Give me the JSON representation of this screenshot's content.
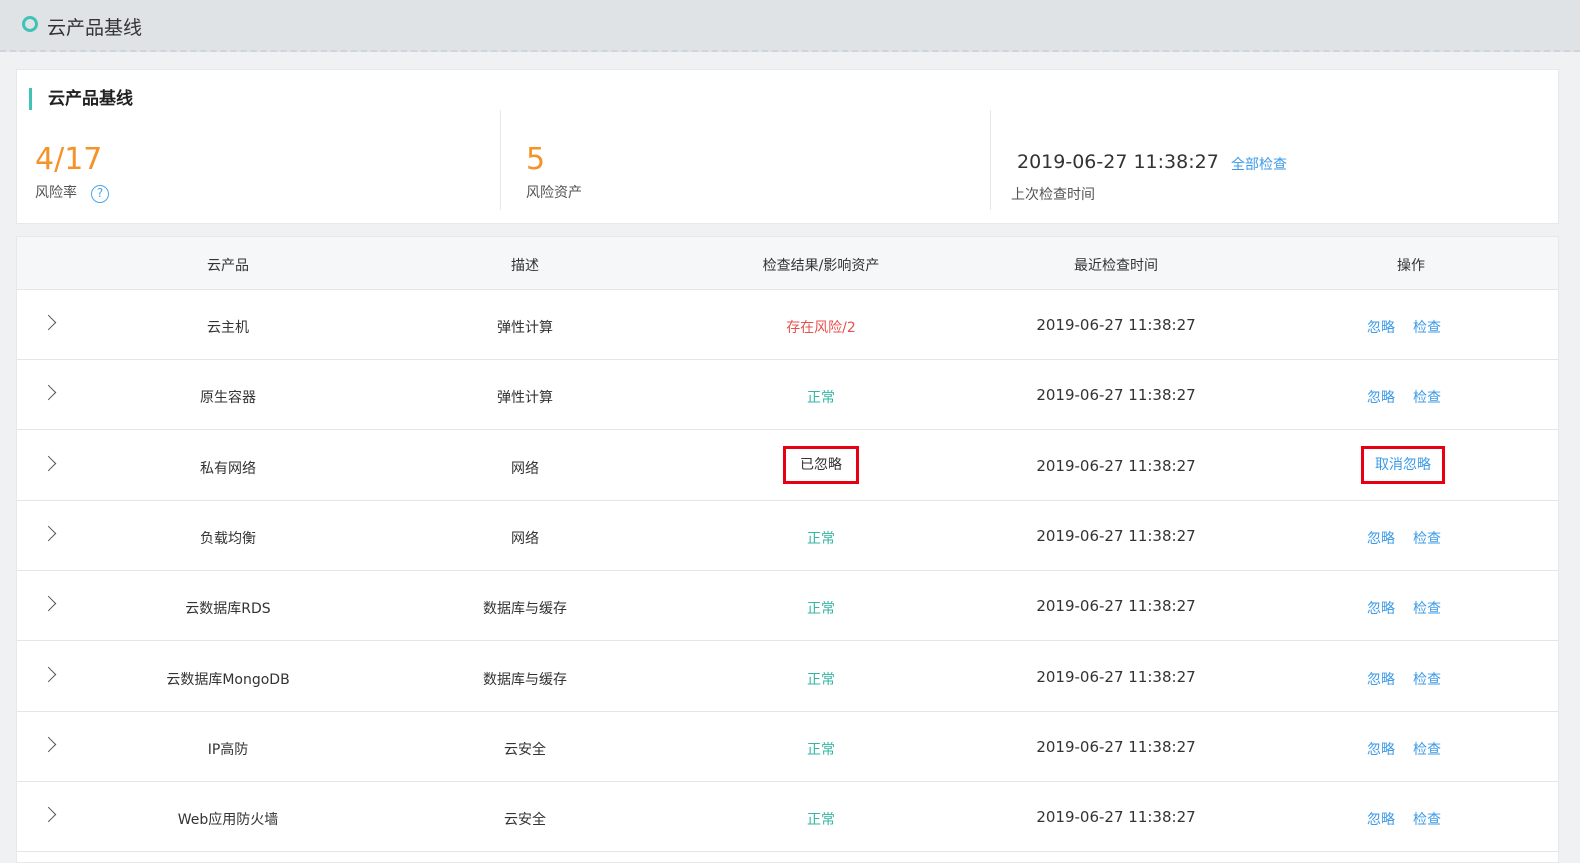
{
  "header": {
    "title": "云产品基线"
  },
  "summary": {
    "section_title": "云产品基线",
    "risk_rate_value": "4/17",
    "risk_rate_label": "风险率",
    "risk_assets_value": "5",
    "risk_assets_label": "风险资产",
    "last_check_time": "2019-06-27 11:38:27",
    "check_all_label": "全部检查",
    "last_check_label": "上次检查时间"
  },
  "table": {
    "columns": [
      "云产品",
      "描述",
      "检查结果/影响资产",
      "最近检查时间",
      "操作"
    ],
    "rows": [
      {
        "product": "云主机",
        "desc": "弹性计算",
        "result": "存在风险/2",
        "status": "risk",
        "time": "2019-06-27 11:38:27",
        "actions": [
          "忽略",
          "检查"
        ]
      },
      {
        "product": "原生容器",
        "desc": "弹性计算",
        "result": "正常",
        "status": "ok",
        "time": "2019-06-27 11:38:27",
        "actions": [
          "忽略",
          "检查"
        ]
      },
      {
        "product": "私有网络",
        "desc": "网络",
        "result": "已忽略",
        "status": "ignored",
        "time": "2019-06-27 11:38:27",
        "actions": [
          "取消忽略"
        ]
      },
      {
        "product": "负载均衡",
        "desc": "网络",
        "result": "正常",
        "status": "ok",
        "time": "2019-06-27 11:38:27",
        "actions": [
          "忽略",
          "检查"
        ]
      },
      {
        "product": "云数据库RDS",
        "desc": "数据库与缓存",
        "result": "正常",
        "status": "ok",
        "time": "2019-06-27 11:38:27",
        "actions": [
          "忽略",
          "检查"
        ]
      },
      {
        "product": "云数据库MongoDB",
        "desc": "数据库与缓存",
        "result": "正常",
        "status": "ok",
        "time": "2019-06-27 11:38:27",
        "actions": [
          "忽略",
          "检查"
        ]
      },
      {
        "product": "IP高防",
        "desc": "云安全",
        "result": "正常",
        "status": "ok",
        "time": "2019-06-27 11:38:27",
        "actions": [
          "忽略",
          "检查"
        ]
      },
      {
        "product": "Web应用防火墙",
        "desc": "云安全",
        "result": "正常",
        "status": "ok",
        "time": "2019-06-27 11:38:27",
        "actions": [
          "忽略",
          "检查"
        ]
      }
    ]
  },
  "colors": {
    "accent": "#41c2b6",
    "risk": "#e8524e",
    "ok": "#33b6a3",
    "link": "#3c9be8",
    "highlight_box": "#e60012",
    "number": "#f5922a"
  },
  "icons": [
    "status-ring-icon",
    "help-icon",
    "chevron-right-icon"
  ]
}
